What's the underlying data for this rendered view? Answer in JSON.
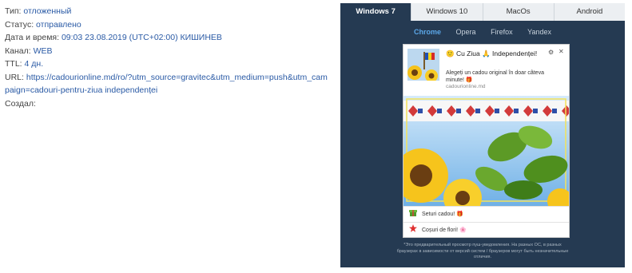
{
  "details": {
    "type_label": "Тип:",
    "type_value": "отложенный",
    "status_label": "Статус:",
    "status_value": "отправлено",
    "datetime_label": "Дата и время:",
    "datetime_value": "09:03 23.08.2019 (UTC+02:00) КИШИНЕВ",
    "channel_label": "Канал:",
    "channel_value": "WEB",
    "ttl_label": "TTL:",
    "ttl_value": "4 дн.",
    "url_label": "URL:",
    "url_value": "https://cadourionline.md/ro/?utm_source=gravitec&utm_medium=push&utm_campaign=cadouri-pentru-ziua independenței",
    "created_label": "Создал:"
  },
  "preview": {
    "os_tabs": [
      "Windows 7",
      "Windows 10",
      "MacOs",
      "Android"
    ],
    "active_os": "Windows 7",
    "browser_tabs": [
      "Chrome",
      "Opera",
      "Firefox",
      "Yandex"
    ],
    "active_browser": "Chrome",
    "notification": {
      "title": "🙂 Cu Ziua 🙏 Independenței!",
      "body": "Alegeți un cadou original în doar câteva minute! 🎁",
      "domain": "cadourionline.md",
      "actions": [
        {
          "icon": "gift-box-icon",
          "label": "Seturi cadou! 🎁"
        },
        {
          "icon": "star-flower-icon",
          "label": "Coșuri de flori! 🌸"
        }
      ]
    },
    "note": "*Это предварительный просмотр пуш-уведомления. На разных ОС, в разных браузерах в зависимости от версий систем / браузеров могут быть незначительные отличия."
  },
  "colors": {
    "panel_bg": "#253a52",
    "link": "#2a5aa5",
    "active_browser": "#5ba7e8"
  }
}
